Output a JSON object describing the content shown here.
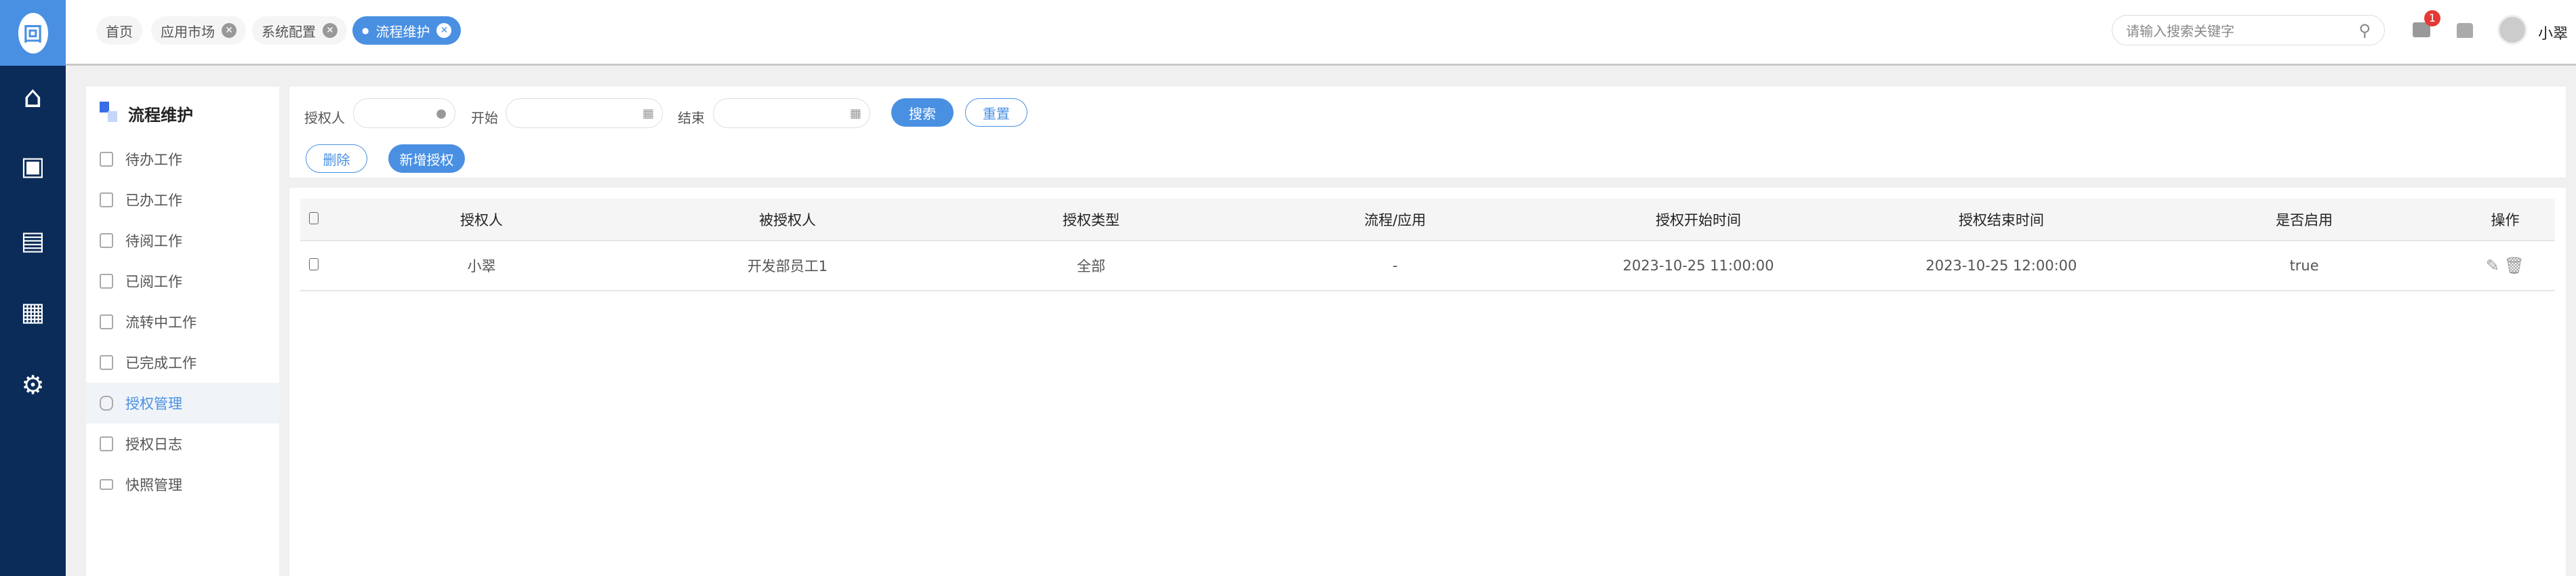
{
  "sidebar": {
    "icons": [
      "logo-icon",
      "home-icon",
      "desktop-user-icon",
      "news-icon",
      "calendar-icon",
      "user-settings-icon"
    ]
  },
  "tabs": [
    {
      "label": "首页",
      "closable": false
    },
    {
      "label": "应用市场",
      "closable": true
    },
    {
      "label": "系统配置",
      "closable": true
    },
    {
      "label": "流程维护",
      "closable": true,
      "active": true
    }
  ],
  "header": {
    "search_placeholder": "请输入搜索关键字",
    "badge": "1",
    "username": "小翠"
  },
  "menu": {
    "title": "流程维护",
    "items": [
      "待办工作",
      "已办工作",
      "待阅工作",
      "已阅工作",
      "流转中工作",
      "已完成工作",
      "授权管理",
      "授权日志",
      "快照管理"
    ],
    "active": "授权管理"
  },
  "filter": {
    "grantor_label": "授权人",
    "start_label": "开始",
    "end_label": "结束",
    "search": "搜索",
    "reset": "重置",
    "delete": "删除",
    "add": "新增授权"
  },
  "table": {
    "headers": [
      "授权人",
      "被授权人",
      "授权类型",
      "流程/应用",
      "授权开始时间",
      "授权结束时间",
      "是否启用",
      "操作"
    ],
    "rows": [
      [
        "小翠",
        "开发部员工1",
        "全部",
        "-",
        "2023-10-25 11:00:00",
        "2023-10-25 12:00:00",
        "true"
      ]
    ]
  },
  "colors": {
    "accent": "#4a90e2",
    "sidebar": "#0b2c58"
  }
}
